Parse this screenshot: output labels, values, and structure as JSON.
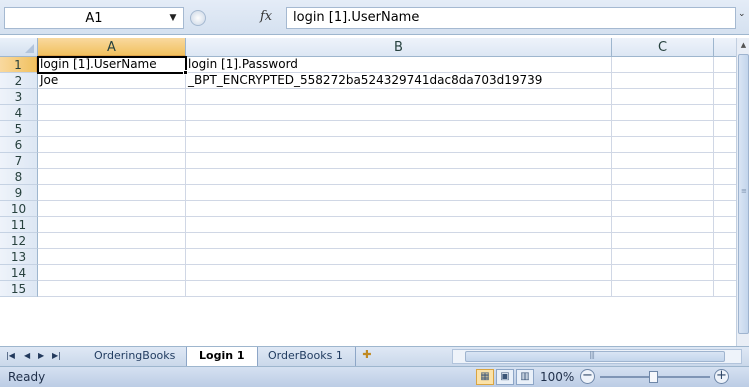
{
  "formula_bar": {
    "name_box": "A1",
    "fx_label": "fx",
    "formula": "login [1].UserName"
  },
  "columns": [
    "A",
    "B",
    "C"
  ],
  "rows": [
    "1",
    "2",
    "3",
    "4",
    "5",
    "6",
    "7",
    "8",
    "9",
    "10",
    "11",
    "12",
    "13",
    "14",
    "15"
  ],
  "cells": {
    "A1": "login [1].UserName",
    "B1": "login [1].Password",
    "A2": "Joe",
    "B2": "_BPT_ENCRYPTED_558272ba524329741dac8da703d19739"
  },
  "sheet_tabs": [
    "OrderingBooks",
    "Login 1",
    "OrderBooks 1"
  ],
  "active_sheet": "Login 1",
  "status": {
    "ready": "Ready",
    "zoom": "100%"
  },
  "colors": {
    "header_active": "#f1c15f",
    "grid_line": "#d0d7e5",
    "chrome": "#d5e1f0"
  }
}
